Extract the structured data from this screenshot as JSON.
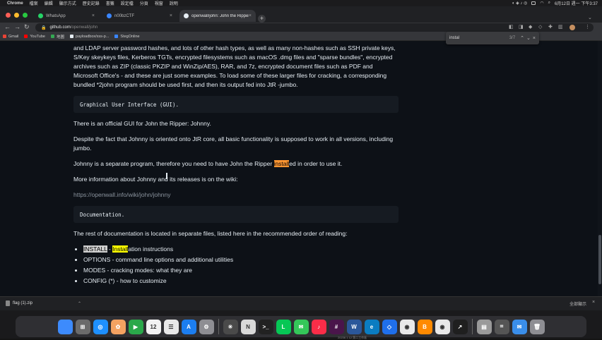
{
  "menubar": {
    "app_name": "Chrome",
    "items": [
      "檔案",
      "編輯",
      "顯示方式",
      "歷史記錄",
      "書籤",
      "設定檔",
      "分頁",
      "視窗",
      "說明"
    ],
    "clock": "6月12日 週一 下午3:37"
  },
  "tabs": [
    {
      "label": "WhatsApp",
      "active": false,
      "icon_color": "#25d366"
    },
    {
      "label": "n00bzCTF",
      "active": false,
      "icon_color": "#3a86ff"
    },
    {
      "label": "openwall/john: John the Ripper",
      "active": true,
      "icon_color": "#e6edf3"
    }
  ],
  "address_bar": {
    "host": "github.com",
    "path": "/openwall/john"
  },
  "bookmarks": [
    {
      "label": "Gmail",
      "icon_color": "#ea4335"
    },
    {
      "label": "YouTube",
      "icon_color": "#ff0000"
    },
    {
      "label": "地圖",
      "icon_color": "#34a853"
    },
    {
      "label": "payloadbox/xss-p...",
      "icon_color": "#e6edf3"
    },
    {
      "label": "StegOnline",
      "icon_color": "#3a86ff"
    }
  ],
  "find_bar": {
    "query": "instal",
    "count": "3/7"
  },
  "article": {
    "line1": "and LDAP server password hashes, and lots of other hash types, as well as many non-hashes such as SSH private keys, S/Key skeykeys files, Kerberos TGTs, encrypted filesystems such as macOS .dmg files and \"sparse bundles\", encrypted archives such as ZIP (classic PKZIP and WinZip/AES), RAR, and 7z, encrypted document files such as PDF and Microsoft Office's - and these are just some examples. To load some of these larger files for cracking, a corresponding bundled *2john program should be used first, and then its output fed into JtR -jumbo.",
    "code_gui": "Graphical User Interface (GUI).",
    "p_gui": "There is an official GUI for John the Ripper: Johnny.",
    "p_despite": "Despite the fact that Johnny is oriented onto JtR core, all basic functionality is supposed to work in all versions, including jumbo.",
    "p_johnny_before": "Johnny is a separate program, therefore you need to have John the Ripper ",
    "p_johnny_match": "install",
    "p_johnny_after": "ed in order to use it.",
    "p_more": "More information about Johnny and its releases is on the wiki:",
    "wiki_link": "https://openwall.info/wiki/john/johnny",
    "code_doc": "Documentation.",
    "p_rest": "The rest of documentation is located in separate files, listed here in the recommended order of reading:",
    "list": {
      "item1_file": "INSTALL",
      "item1_dash": " - ",
      "item1_match": "Install",
      "item1_rest": "ation instructions",
      "item2": "OPTIONS - command line options and additional utilities",
      "item3": "MODES - cracking modes: what they are",
      "item4": "CONFIG (*) - how to customize"
    }
  },
  "download_bar": {
    "file": "flag (1).zip",
    "show_all": "全部顯示"
  },
  "dock_caption": "20236 1 12 第二工作區",
  "dock": [
    {
      "name": "finder-icon",
      "color": "#3d8bfd",
      "glyph": ""
    },
    {
      "name": "launchpad-icon",
      "color": "#6b6b6b",
      "glyph": "⊞"
    },
    {
      "name": "safari-icon",
      "color": "#1e90ff",
      "glyph": "◎"
    },
    {
      "name": "photos-icon",
      "color": "#f4a261",
      "glyph": "✿"
    },
    {
      "name": "facetime-icon",
      "color": "#2aa84a",
      "glyph": "▶"
    },
    {
      "name": "calendar-icon",
      "color": "#f2f2f2",
      "glyph": "12"
    },
    {
      "name": "reminders-icon",
      "color": "#e8e8e8",
      "glyph": "☰"
    },
    {
      "name": "appstore-icon",
      "color": "#1c7ef0",
      "glyph": "A"
    },
    {
      "name": "settings-icon",
      "color": "#8e8e93",
      "glyph": "⚙"
    },
    {
      "name": "sep"
    },
    {
      "name": "chatgpt-icon",
      "color": "#4a4a4a",
      "glyph": "✳"
    },
    {
      "name": "notes-icon",
      "color": "#d9d9d9",
      "glyph": "N"
    },
    {
      "name": "terminal-icon",
      "color": "#222222",
      "glyph": ">_"
    },
    {
      "name": "line-icon",
      "color": "#06c755",
      "glyph": "L"
    },
    {
      "name": "messages-icon",
      "color": "#34c759",
      "glyph": "✉"
    },
    {
      "name": "music-icon",
      "color": "#fa2d48",
      "glyph": "♪"
    },
    {
      "name": "slack-icon",
      "color": "#4a154b",
      "glyph": "#"
    },
    {
      "name": "word-icon",
      "color": "#2b579a",
      "glyph": "W"
    },
    {
      "name": "edge-icon",
      "color": "#0b7cc1",
      "glyph": "e"
    },
    {
      "name": "vscode-icon",
      "color": "#1f6feb",
      "glyph": "◇"
    },
    {
      "name": "chrome-icon",
      "color": "#e9e9e9",
      "glyph": "◉"
    },
    {
      "name": "books-icon",
      "color": "#ff8a00",
      "glyph": "B"
    },
    {
      "name": "chrome-alt-icon",
      "color": "#e9e9e9",
      "glyph": "◉"
    },
    {
      "name": "stocks-icon",
      "color": "#1f1f1f",
      "glyph": "↗"
    },
    {
      "name": "sep"
    },
    {
      "name": "preview-icon",
      "color": "#9a9a9a",
      "glyph": "▤"
    },
    {
      "name": "screenshot-icon",
      "color": "#555555",
      "glyph": "⌗"
    },
    {
      "name": "mail-icon",
      "color": "#3a8eea",
      "glyph": "✉"
    },
    {
      "name": "trash-icon",
      "color": "#8e8e93",
      "glyph": "🗑"
    }
  ]
}
